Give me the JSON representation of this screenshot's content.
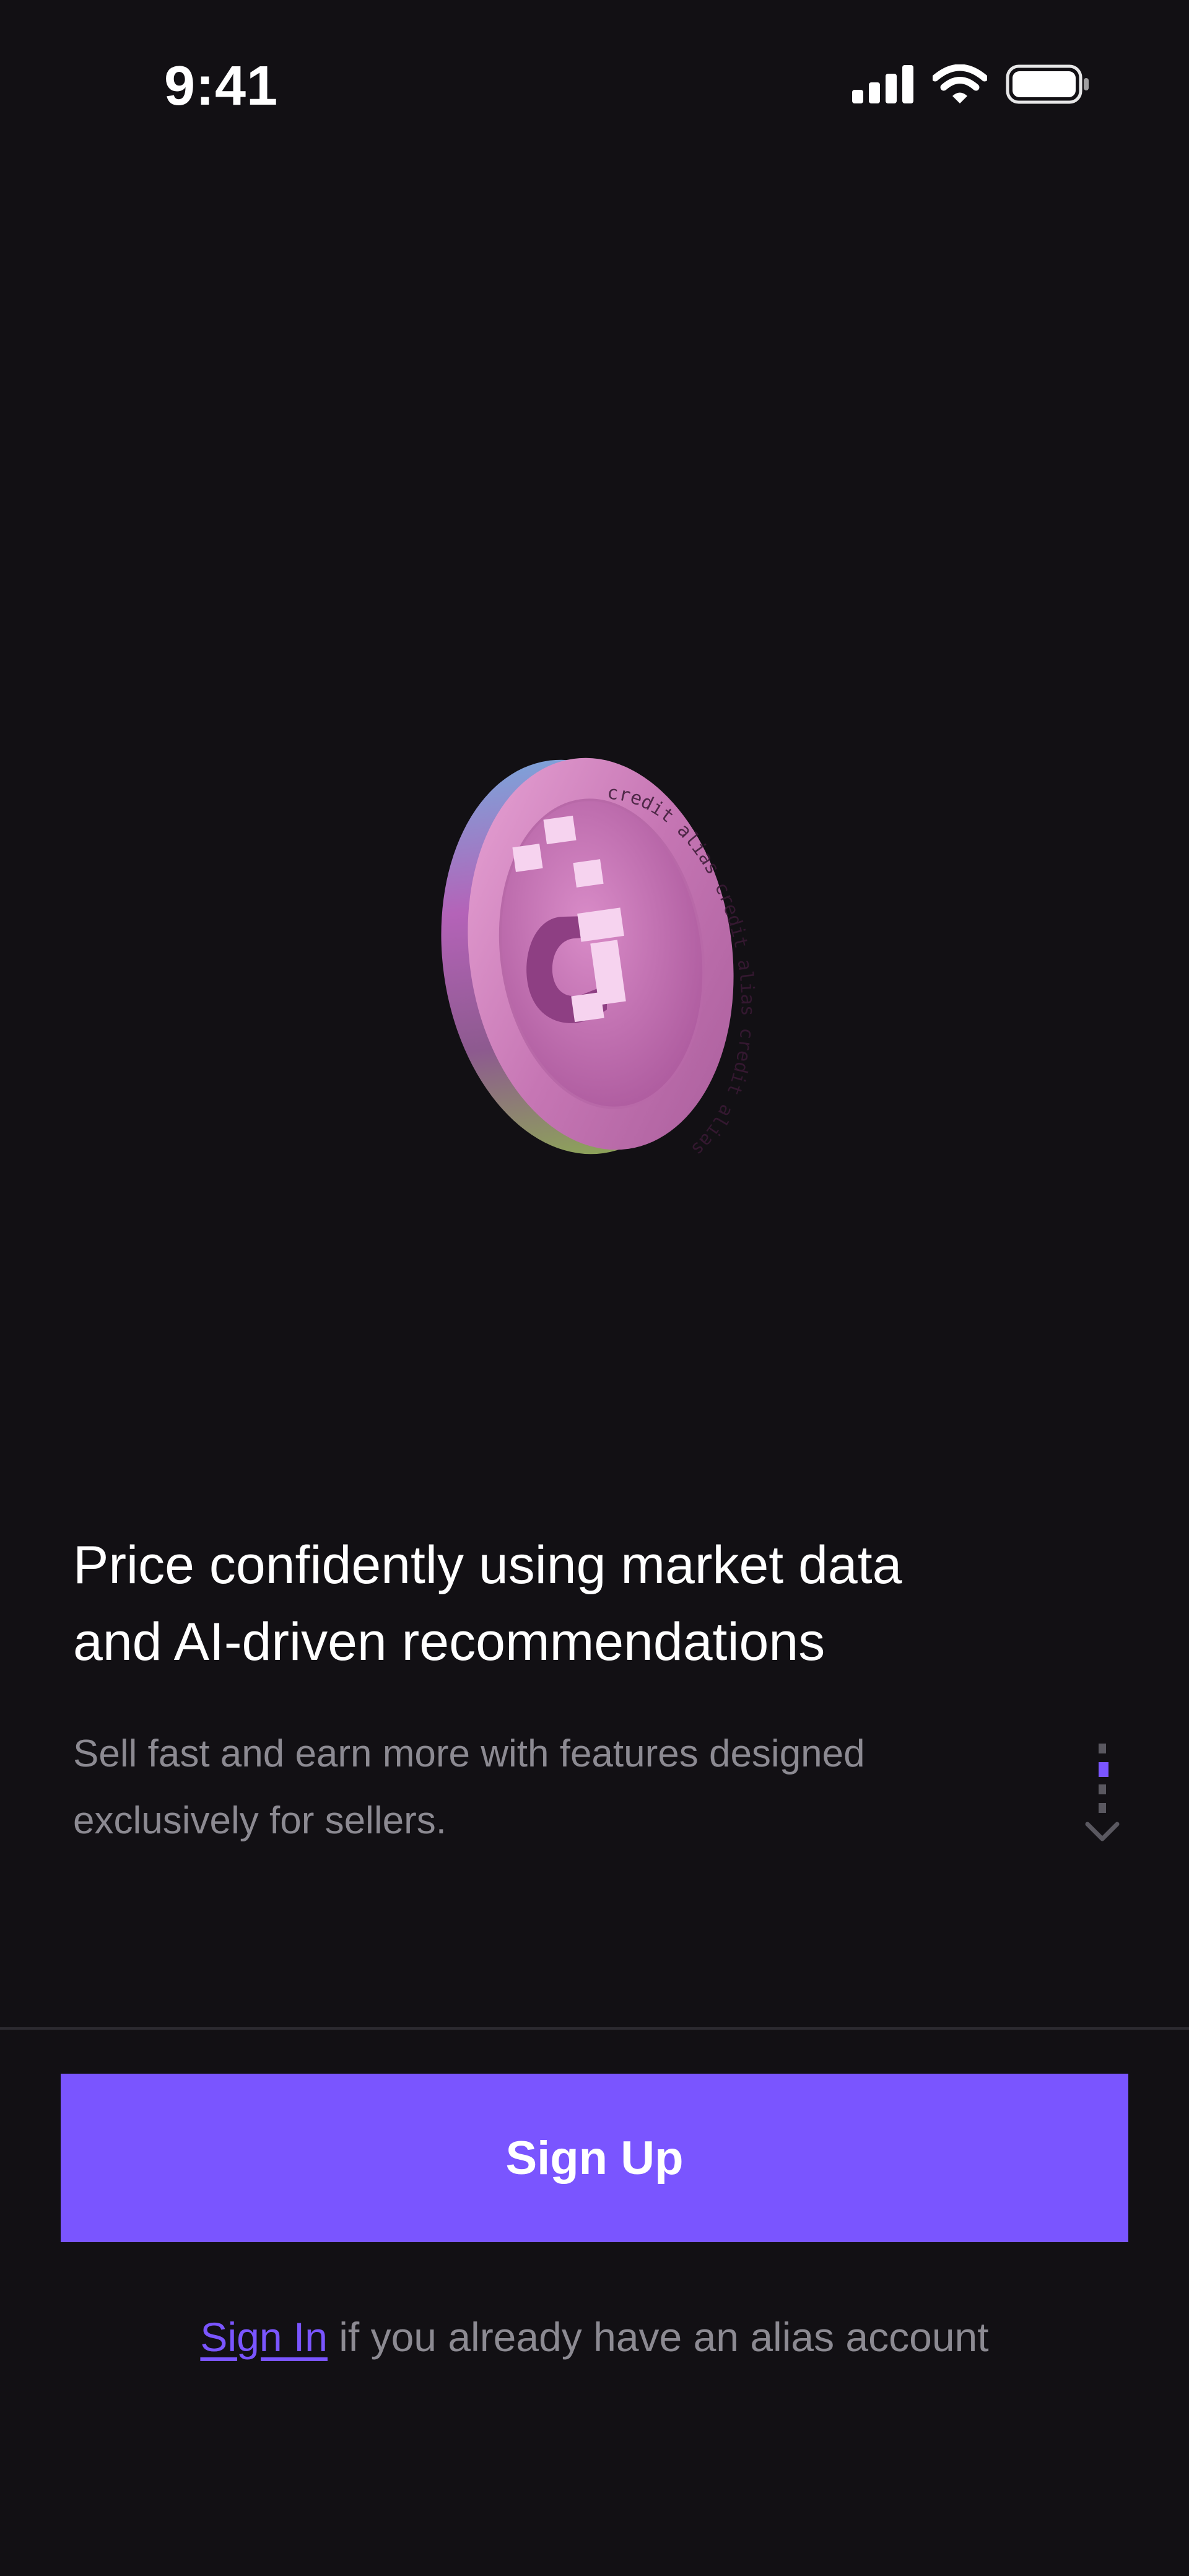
{
  "status_bar": {
    "time": "9:41",
    "icons": [
      "signal-icon",
      "wifi-icon",
      "battery-icon"
    ]
  },
  "hero": {
    "icon": "alias-credit-coin-icon",
    "coin_inscription": "credit alias credit alias credit alias"
  },
  "onboarding": {
    "headline_line1": "Price confidently using market data",
    "headline_line2": "and AI-driven recommendations",
    "subtitle_line1": "Sell fast and earn more with features designed",
    "subtitle_line2": "exclusively for sellers.",
    "scroll_indicator_icon": "scroll-down-indicator-icon"
  },
  "actions": {
    "signup_label": "Sign Up",
    "signin_link_label": "Sign In",
    "signin_suffix": " if you already have an alias account"
  },
  "colors": {
    "background": "#121014",
    "accent": "#7a55ff",
    "muted_text": "#8c8a92",
    "divider": "#2c2a30"
  }
}
